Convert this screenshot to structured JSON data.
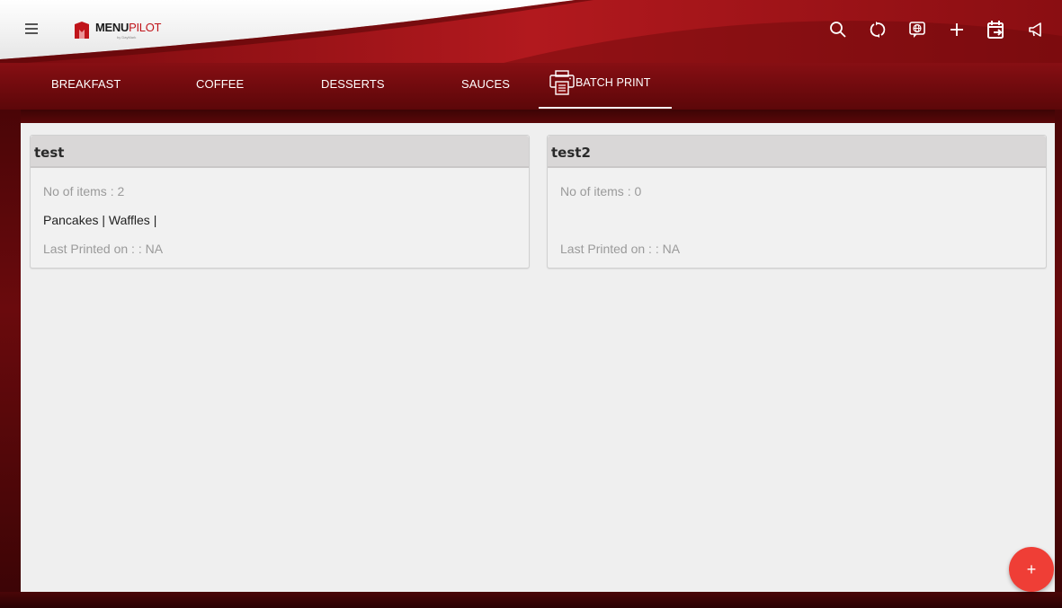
{
  "app": {
    "logo_main": "MENU",
    "logo_accent": "PILOT",
    "logo_sub": "by DayMark"
  },
  "header": {
    "actions": [
      {
        "icon": "search-icon"
      },
      {
        "icon": "sync-icon"
      },
      {
        "icon": "language-icon"
      },
      {
        "icon": "plus-icon"
      },
      {
        "icon": "calendar-export-icon"
      },
      {
        "icon": "announcement-icon"
      }
    ]
  },
  "tabs": [
    {
      "label": "BREAKFAST"
    },
    {
      "label": "COFFEE"
    },
    {
      "label": "DESSERTS"
    },
    {
      "label": "SAUCES"
    },
    {
      "label": "BATCH PRINT",
      "active": true,
      "icon": "printer-icon"
    }
  ],
  "cards": [
    {
      "title": "test",
      "items_count": "No of items : 2",
      "items": "Pancakes | Waffles |",
      "last_printed": "Last Printed on : : NA"
    },
    {
      "title": "test2",
      "items_count": "No of items : 0",
      "items": "",
      "last_printed": "Last Printed on : : NA"
    }
  ],
  "fab": {
    "label": "+"
  },
  "colors": {
    "brand_red": "#a3161b",
    "fab": "#ef3e36",
    "card_header": "#d9d7d7"
  }
}
